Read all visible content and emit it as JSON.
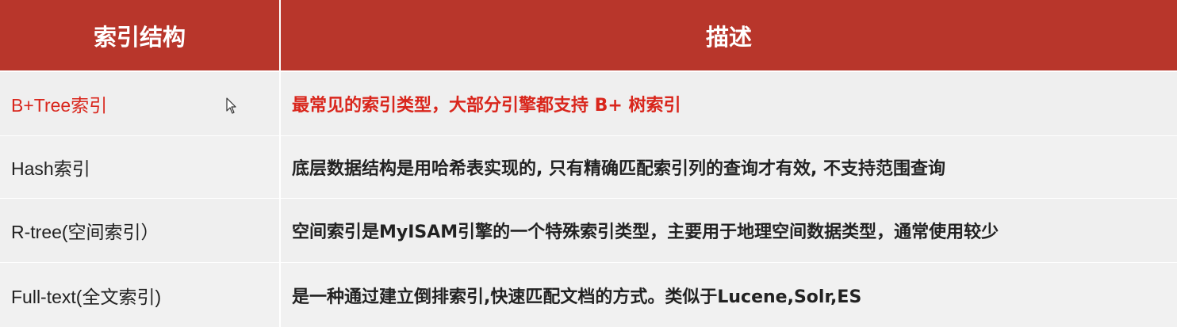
{
  "table": {
    "headers": {
      "structure": "索引结构",
      "description": "描述"
    },
    "rows": [
      {
        "structure": "B+Tree索引",
        "description": "最常见的索引类型，大部分引擎都支持 B+ 树索引",
        "highlighted": true
      },
      {
        "structure": "Hash索引",
        "description": "底层数据结构是用哈希表实现的, 只有精确匹配索引列的查询才有效, 不支持范围查询",
        "highlighted": false
      },
      {
        "structure": "R-tree(空间索引）",
        "description": "空间索引是MyISAM引擎的一个特殊索引类型，主要用于地理空间数据类型，通常使用较少",
        "highlighted": false
      },
      {
        "structure": "Full-text(全文索引)",
        "description": "是一种通过建立倒排索引,快速匹配文档的方式。类似于Lucene,Solr,ES",
        "highlighted": false
      }
    ]
  },
  "colors": {
    "header_bg": "#b8362b",
    "header_text": "#ffffff",
    "row_bg": "#f1f1f1",
    "highlight_text": "#d9261c",
    "body_text": "#222222"
  },
  "cursor_icon": "mouse-pointer-icon"
}
